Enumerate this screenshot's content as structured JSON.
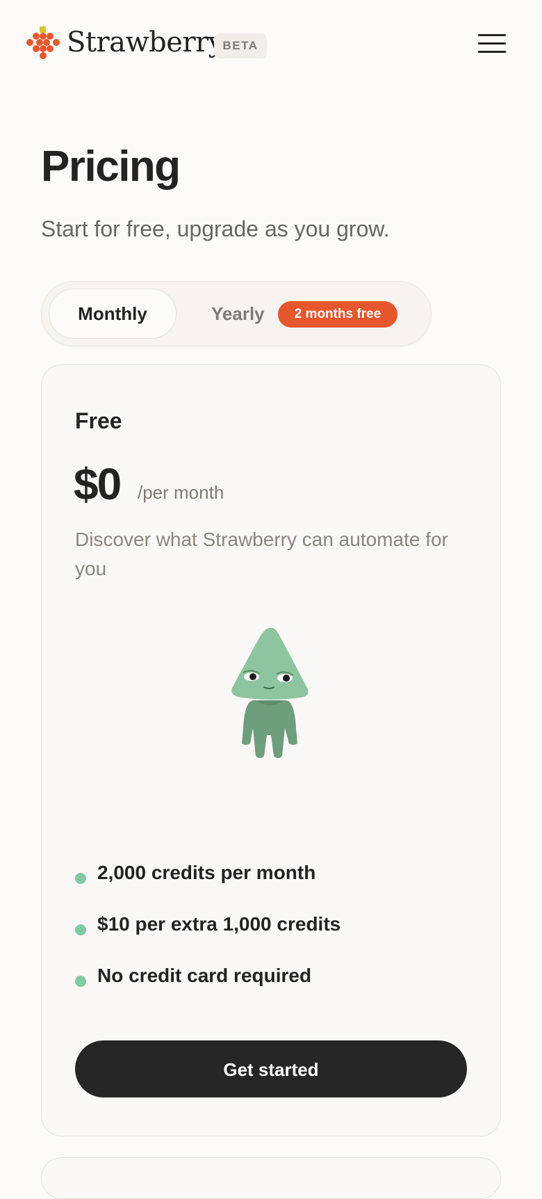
{
  "header": {
    "brand": "Strawberry",
    "beta_badge": "BETA",
    "logo_icon": "strawberry-logo-icon",
    "menu_icon": "hamburger-menu-icon"
  },
  "hero": {
    "title": "Pricing",
    "subtitle": "Start for free, upgrade as you grow."
  },
  "billing_toggle": {
    "monthly_label": "Monthly",
    "yearly_label": "Yearly",
    "promo_badge": "2 months free",
    "selected": "Monthly"
  },
  "plan": {
    "name": "Free",
    "price": "$0",
    "period": "/per month",
    "description": "Discover what Strawberry can automate for you",
    "mascot_icon": "green-mascot-illustration",
    "features": [
      "2,000 credits per month",
      "$10 per extra 1,000 credits",
      "No credit card required"
    ],
    "cta_label": "Get started"
  },
  "colors": {
    "background": "#fcfbfa",
    "accent_orange": "#e6572e",
    "feature_dot": "#82c9a2",
    "button_dark": "#262626"
  }
}
